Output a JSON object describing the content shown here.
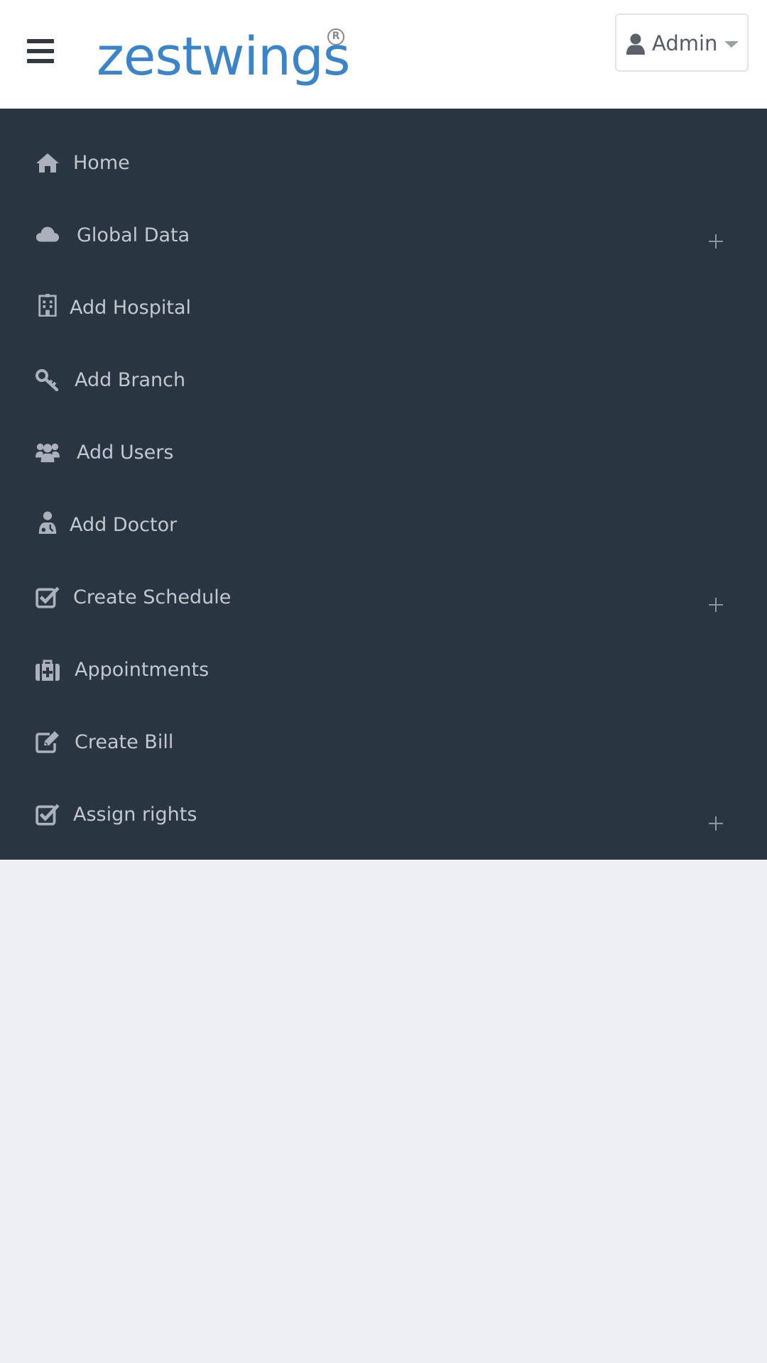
{
  "header": {
    "logo_text": "zestwings",
    "logo_mark": "R",
    "menu_icon": "hamburger-menu-icon",
    "user": {
      "name": "Admin",
      "icon": "user-icon",
      "dropdown_icon": "caret-down-icon"
    }
  },
  "sidebar": {
    "items": [
      {
        "label": "Home",
        "icon": "home-icon",
        "expandable": false
      },
      {
        "label": "Global Data",
        "icon": "cloud-icon",
        "expandable": true
      },
      {
        "label": "Add Hospital",
        "icon": "hospital-icon",
        "expandable": false
      },
      {
        "label": "Add Branch",
        "icon": "key-icon",
        "expandable": false
      },
      {
        "label": "Add Users",
        "icon": "users-icon",
        "expandable": false
      },
      {
        "label": "Add Doctor",
        "icon": "doctor-icon",
        "expandable": false
      },
      {
        "label": "Create Schedule",
        "icon": "checkbox-icon",
        "expandable": true
      },
      {
        "label": "Appointments",
        "icon": "medkit-icon",
        "expandable": false
      },
      {
        "label": "Create Bill",
        "icon": "edit-icon",
        "expandable": false
      },
      {
        "label": "Assign rights",
        "icon": "checkbox-icon",
        "expandable": true
      }
    ]
  },
  "colors": {
    "header_bg": "#ffffff",
    "sidebar_bg": "#2a3542",
    "sidebar_text": "#c3c7ce",
    "sidebar_icon": "#aab1ba",
    "content_bg": "#eff0f5",
    "logo_blue": "#3a84c9",
    "user_text": "#555b62"
  }
}
